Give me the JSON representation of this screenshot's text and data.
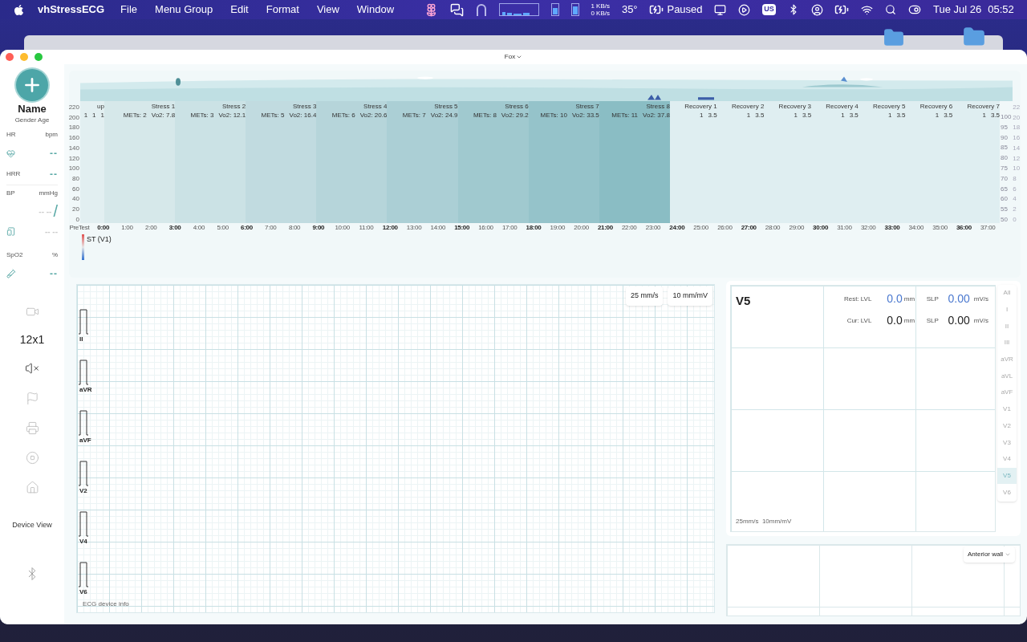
{
  "menubar": {
    "app_name": "vhStressECG",
    "menus": [
      "File",
      "Menu Group",
      "Edit",
      "Format",
      "View",
      "Window"
    ],
    "net_up": "1 KB/s",
    "net_down": "0 KB/s",
    "temperature": "35°",
    "media_status": "Paused",
    "input_source": "US",
    "date": "Tue Jul 26",
    "time": "05:52"
  },
  "window": {
    "title": "Fox"
  },
  "patient": {
    "name": "Name",
    "details": "Gender Age"
  },
  "vitals": {
    "hr": {
      "label": "HR",
      "unit": "bpm",
      "value": "--"
    },
    "hrr": {
      "label": "HRR",
      "value": "--"
    },
    "bp": {
      "label": "BP",
      "unit": "mmHg",
      "value": "-- --",
      "separator": "/"
    },
    "device": {
      "value": "-- --"
    },
    "spo2": {
      "label": "SpO2",
      "unit": "%",
      "value": "--"
    }
  },
  "layout_mode": "12x1",
  "sound_muted": true,
  "device_view": "Device View",
  "stress_chart": {
    "y_ticks": [
      "220",
      "200",
      "180",
      "160",
      "140",
      "120",
      "100",
      "80",
      "60",
      "40",
      "20",
      "0"
    ],
    "right_ticks": [
      "100",
      "95",
      "90",
      "85",
      "80",
      "75",
      "70",
      "65",
      "60",
      "55",
      "50"
    ],
    "right_ticks_2": [
      "22",
      "20",
      "18",
      "16",
      "14",
      "12",
      "10",
      "8",
      "6",
      "4",
      "2",
      "0"
    ],
    "stages": [
      {
        "kind": "pretest",
        "name": "up",
        "metrics": [
          "1",
          "1",
          "1"
        ]
      },
      {
        "kind": "stress",
        "name": "Stress 1",
        "metrics": [
          "METs: 2",
          "Vo2: 7.8"
        ]
      },
      {
        "kind": "stress",
        "name": "Stress 2",
        "metrics": [
          "METs: 3",
          "Vo2: 12.1"
        ]
      },
      {
        "kind": "stress",
        "name": "Stress 3",
        "metrics": [
          "METs: 5",
          "Vo2: 16.4"
        ]
      },
      {
        "kind": "stress",
        "name": "Stress 4",
        "metrics": [
          "METs: 6",
          "Vo2: 20.6"
        ]
      },
      {
        "kind": "stress",
        "name": "Stress 5",
        "metrics": [
          "METs: 7",
          "Vo2: 24.9"
        ]
      },
      {
        "kind": "stress",
        "name": "Stress 6",
        "metrics": [
          "METs: 8",
          "Vo2: 29.2"
        ]
      },
      {
        "kind": "stress",
        "name": "Stress 7",
        "metrics": [
          "METs: 10",
          "Vo2: 33.5"
        ]
      },
      {
        "kind": "stress",
        "name": "Stress 8",
        "metrics": [
          "METs: 11",
          "Vo2: 37.8"
        ]
      },
      {
        "kind": "recovery",
        "name": "Recovery 1",
        "metrics": [
          "1",
          "3.5"
        ]
      },
      {
        "kind": "recovery",
        "name": "Recovery 2",
        "metrics": [
          "1",
          "3.5"
        ]
      },
      {
        "kind": "recovery",
        "name": "Recovery 3",
        "metrics": [
          "1",
          "3.5"
        ]
      },
      {
        "kind": "recovery",
        "name": "Recovery 4",
        "metrics": [
          "1",
          "3.5"
        ]
      },
      {
        "kind": "recovery",
        "name": "Recovery 5",
        "metrics": [
          "1",
          "3.5"
        ]
      },
      {
        "kind": "recovery",
        "name": "Recovery 6",
        "metrics": [
          "1",
          "3.5"
        ]
      },
      {
        "kind": "recovery",
        "name": "Recovery 7",
        "metrics": [
          "1",
          "3.5"
        ]
      }
    ],
    "time_ticks": [
      {
        "label": "PreTest",
        "major": false
      },
      {
        "label": "0:00",
        "major": true
      },
      {
        "label": "1:00",
        "major": false
      },
      {
        "label": "2:00",
        "major": false
      },
      {
        "label": "3:00",
        "major": true
      },
      {
        "label": "4:00",
        "major": false
      },
      {
        "label": "5:00",
        "major": false
      },
      {
        "label": "6:00",
        "major": true
      },
      {
        "label": "7:00",
        "major": false
      },
      {
        "label": "8:00",
        "major": false
      },
      {
        "label": "9:00",
        "major": true
      },
      {
        "label": "10:00",
        "major": false
      },
      {
        "label": "11:00",
        "major": false
      },
      {
        "label": "12:00",
        "major": true
      },
      {
        "label": "13:00",
        "major": false
      },
      {
        "label": "14:00",
        "major": false
      },
      {
        "label": "15:00",
        "major": true
      },
      {
        "label": "16:00",
        "major": false
      },
      {
        "label": "17:00",
        "major": false
      },
      {
        "label": "18:00",
        "major": true
      },
      {
        "label": "19:00",
        "major": false
      },
      {
        "label": "20:00",
        "major": false
      },
      {
        "label": "21:00",
        "major": true
      },
      {
        "label": "22:00",
        "major": false
      },
      {
        "label": "23:00",
        "major": false
      },
      {
        "label": "24:00",
        "major": true
      },
      {
        "label": "25:00",
        "major": false
      },
      {
        "label": "26:00",
        "major": false
      },
      {
        "label": "27:00",
        "major": true
      },
      {
        "label": "28:00",
        "major": false
      },
      {
        "label": "29:00",
        "major": false
      },
      {
        "label": "30:00",
        "major": true
      },
      {
        "label": "31:00",
        "major": false
      },
      {
        "label": "32:00",
        "major": false
      },
      {
        "label": "33:00",
        "major": true
      },
      {
        "label": "34:00",
        "major": false
      },
      {
        "label": "35:00",
        "major": false
      },
      {
        "label": "36:00",
        "major": true
      },
      {
        "label": "37:00",
        "major": false
      }
    ]
  },
  "st_panel": {
    "title": "ST (V1)"
  },
  "ecg": {
    "speed": "25 mm/s",
    "gain": "10 mm/mV",
    "leads": [
      "II",
      "aVR",
      "aVF",
      "V2",
      "V4",
      "V6"
    ],
    "footer": "ECG device info"
  },
  "lead_detail": {
    "lead": "V5",
    "rows": [
      {
        "kind": "rest",
        "label": "Rest:",
        "lvl_label": "LVL",
        "lvl": "0.0",
        "lvl_unit": "mm",
        "slp_label": "SLP",
        "slp": "0.00",
        "slp_unit": "mV/s"
      },
      {
        "kind": "current",
        "label": "Cur:",
        "lvl_label": "LVL",
        "lvl": "0.0",
        "lvl_unit": "mm",
        "slp_label": "SLP",
        "slp": "0.00",
        "slp_unit": "mV/s"
      }
    ],
    "footer": "25mm/s  10mm/mV",
    "lead_list": [
      {
        "label": "All",
        "selected": false
      },
      {
        "label": "I",
        "selected": false
      },
      {
        "label": "II",
        "selected": false
      },
      {
        "label": "III",
        "selected": false
      },
      {
        "label": "aVR",
        "selected": false
      },
      {
        "label": "aVL",
        "selected": false
      },
      {
        "label": "aVF",
        "selected": false
      },
      {
        "label": "V1",
        "selected": false
      },
      {
        "label": "V2",
        "selected": false
      },
      {
        "label": "V3",
        "selected": false
      },
      {
        "label": "V4",
        "selected": false
      },
      {
        "label": "V5",
        "selected": true
      },
      {
        "label": "V6",
        "selected": false
      }
    ]
  },
  "wall_view": {
    "region": "Anterior wall"
  }
}
